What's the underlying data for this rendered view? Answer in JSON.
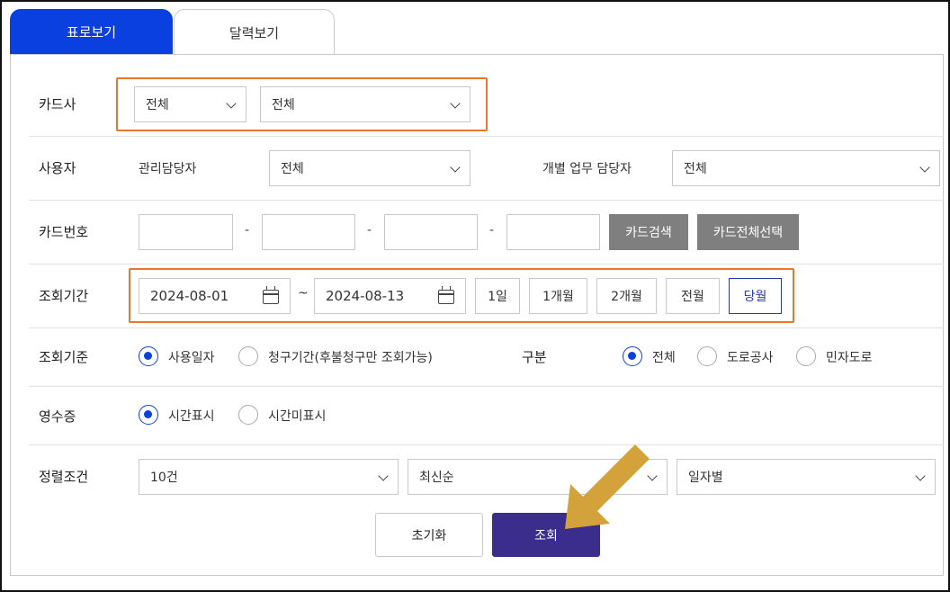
{
  "tabs": [
    {
      "label": "표로보기",
      "active": true
    },
    {
      "label": "달력보기",
      "active": false
    }
  ],
  "card_company": {
    "label": "카드사",
    "select1": "전체",
    "select2": "전체"
  },
  "user": {
    "label": "사용자",
    "manager_label": "관리담당자",
    "manager_value": "전체",
    "individual_label": "개별 업무 담당자",
    "individual_value": "전체"
  },
  "card_number": {
    "label": "카드번호",
    "separator": "-",
    "search_button": "카드검색",
    "select_all_button": "카드전체선택"
  },
  "period": {
    "label": "조회기간",
    "start_date": "2024-08-01",
    "tilde": "~",
    "end_date": "2024-08-13",
    "buttons": [
      "1일",
      "1개월",
      "2개월",
      "전월",
      "당월"
    ],
    "active_button": "당월"
  },
  "criteria": {
    "label": "조회기준",
    "option1": "사용일자",
    "option2": "청구기간(후불청구만 조회가능)",
    "selected": "사용일자",
    "category_label": "구분",
    "cat1": "전체",
    "cat2": "도로공사",
    "cat3": "민자도로",
    "category_selected": "전체"
  },
  "receipt": {
    "label": "영수증",
    "option1": "시간표시",
    "option2": "시간미표시",
    "selected": "시간표시"
  },
  "sort": {
    "label": "정렬조건",
    "count": "10건",
    "order": "최신순",
    "grouping": "일자별"
  },
  "actions": {
    "reset": "초기화",
    "search": "조회"
  },
  "colors": {
    "accent": "#0a3fe0",
    "search_button": "#3a2d8c",
    "highlight": "#e8772a",
    "arrow": "#d4a23a"
  }
}
